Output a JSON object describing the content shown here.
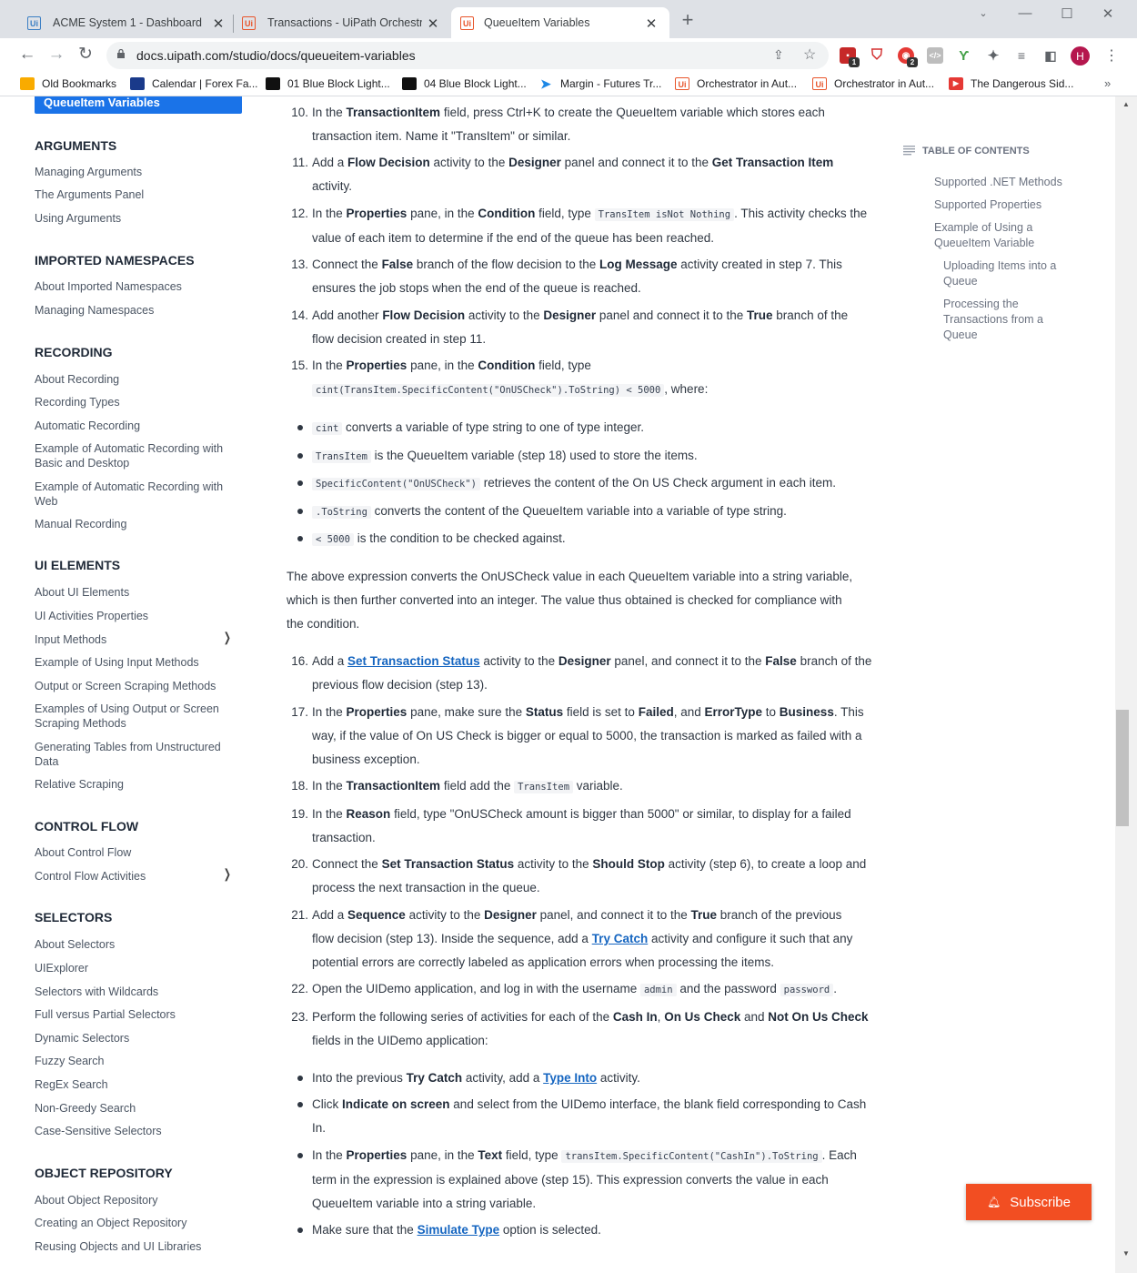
{
  "browser": {
    "tabs": [
      {
        "title": "ACME System 1 - Dashboard",
        "fav": "Ui"
      },
      {
        "title": "Transactions - UiPath Orchestrato",
        "fav": "Ui"
      },
      {
        "title": "QueueItem Variables",
        "fav": "Ui"
      }
    ],
    "new_tab": "+",
    "url": "docs.uipath.com/studio/docs/queueitem-variables",
    "ext_badges": [
      "1",
      "2"
    ],
    "avatar": "H",
    "bookmarks": [
      "Old Bookmarks",
      "Calendar | Forex Fa...",
      "01 Blue Block Light...",
      "04 Blue Block Light...",
      "Margin - Futures Tr...",
      "Orchestrator in Aut...",
      "Orchestrator in Aut...",
      "The Dangerous Sid..."
    ]
  },
  "sidebar": {
    "active": "QueueItem Variables",
    "sections": [
      {
        "head": "ARGUMENTS",
        "items": [
          "Managing Arguments",
          "The Arguments Panel",
          "Using Arguments"
        ]
      },
      {
        "head": "IMPORTED NAMESPACES",
        "items": [
          "About Imported Namespaces",
          "Managing Namespaces"
        ]
      },
      {
        "head": "RECORDING",
        "items": [
          "About Recording",
          "Recording Types",
          "Automatic Recording",
          "Example of Automatic Recording with Basic and Desktop",
          "Example of Automatic Recording with Web",
          "Manual Recording"
        ]
      },
      {
        "head": "UI ELEMENTS",
        "items": [
          "About UI Elements",
          "UI Activities Properties",
          "Input Methods",
          "Example of Using Input Methods",
          "Output or Screen Scraping Methods",
          "Examples of Using Output or Screen Scraping Methods",
          "Generating Tables from Unstructured Data",
          "Relative Scraping"
        ]
      },
      {
        "head": "CONTROL FLOW",
        "items": [
          "About Control Flow",
          "Control Flow Activities"
        ]
      },
      {
        "head": "SELECTORS",
        "items": [
          "About Selectors",
          "UIExplorer",
          "Selectors with Wildcards",
          "Full versus Partial Selectors",
          "Dynamic Selectors",
          "Fuzzy Search",
          "RegEx Search",
          "Non-Greedy Search",
          "Case-Sensitive Selectors"
        ]
      },
      {
        "head": "OBJECT REPOSITORY",
        "items": [
          "About Object Repository",
          "Creating an Object Repository",
          "Reusing Objects and UI Libraries"
        ]
      }
    ]
  },
  "toc": {
    "title": "TABLE OF CONTENTS",
    "items": [
      "Supported .NET Methods",
      "Supported Properties",
      "Example of Using a QueueItem Variable",
      "Uploading Items into a Queue",
      "Processing the Transactions from a Queue"
    ]
  },
  "article": {
    "step10": {
      "n": "10.",
      "a": "In the ",
      "b1": "TransactionItem",
      "c": " field, press Ctrl+K to create the QueueItem variable which stores each",
      "d": "transaction item. Name it \"TransItem\" or similar."
    },
    "step11": {
      "n": "11.",
      "a": "Add a ",
      "b1": "Flow Decision",
      "c": " activity to the ",
      "b2": "Designer",
      "e": " panel and connect it to the ",
      "b3": "Get Transaction Item",
      "f": "activity."
    },
    "step12": {
      "n": "12.",
      "a": "In the ",
      "b1": "Properties",
      "c": " pane, in the ",
      "b2": "Condition",
      "e": " field, type ",
      "code": "TransItem isNot Nothing",
      "g": ". This activity checks the",
      "h": "value of each item to determine if the end of the queue has been reached."
    },
    "step13": {
      "n": "13.",
      "a": "Connect the ",
      "b1": "False",
      "c": " branch of the flow decision to the ",
      "b2": "Log Message",
      "e": " activity created in step 7. This",
      "f": "ensures the job stops when the end of the queue is reached."
    },
    "step14": {
      "n": "14.",
      "a": "Add another ",
      "b1": "Flow Decision",
      "c": " activity to the ",
      "b2": "Designer",
      "e": " panel and connect it to the ",
      "b3": "True",
      "f": " branch of the",
      "g": "flow decision created in step 11."
    },
    "step15": {
      "n": "15.",
      "a": "In the ",
      "b1": "Properties",
      "c": " pane, in the ",
      "b2": "Condition",
      "e": " field, type",
      "code": "cint(TransItem.SpecificContent(\"OnUSCheck\").ToString) < 5000",
      "g": ", where:"
    },
    "bullets15": [
      {
        "code": "cint",
        "t": " converts a variable of type string to one of type integer."
      },
      {
        "code": "TransItem",
        "t": " is the QueueItem variable (step 18) used to store the items."
      },
      {
        "code": "SpecificContent(\"OnUSCheck\")",
        "t": " retrieves the content of the On US Check argument in each item."
      },
      {
        "code": ".ToString",
        "t": " converts the content of the QueueItem variable into a variable of type string."
      },
      {
        "code": "< 5000",
        "t": " is the condition to be checked against."
      }
    ],
    "para": [
      "The above expression converts the OnUSCheck value in each QueueItem variable into a string variable,",
      "which is then further converted into an integer. The value thus obtained is checked for compliance with",
      "the condition."
    ],
    "step16": {
      "n": "16.",
      "a": "Add a ",
      "link": "Set Transaction Status",
      "c": " activity to the ",
      "b1": "Designer",
      "e": " panel, and connect it to the ",
      "b2": "False",
      "f": " branch of the",
      "g": "previous flow decision (step 13)."
    },
    "step17": {
      "n": "17.",
      "a": "In the ",
      "b1": "Properties",
      "c": " pane, make sure the ",
      "b2": "Status",
      "e": " field is set to ",
      "b3": "Failed",
      "f": ", and ",
      "b4": "ErrorType",
      "g": " to ",
      "b5": "Business",
      "h": ". This",
      "i": "way, if the value of On US Check is bigger or equal to 5000, the transaction is marked as failed with a",
      "j": "business exception."
    },
    "step18": {
      "n": "18.",
      "a": "In the ",
      "b1": "TransactionItem",
      "c": " field add the ",
      "code": "TransItem",
      "e": " variable."
    },
    "step19": {
      "n": "19.",
      "a": "In the ",
      "b1": "Reason",
      "c": " field, type \"OnUSCheck amount is bigger than 5000\" or similar, to display for a failed",
      "d": "transaction."
    },
    "step20": {
      "n": "20.",
      "a": "Connect the ",
      "b1": "Set Transaction Status",
      "c": " activity to the ",
      "b2": "Should Stop",
      "e": " activity (step 6), to create a loop and",
      "f": "process the next transaction in the queue."
    },
    "step21": {
      "n": "21.",
      "a": "Add a ",
      "b1": "Sequence",
      "c": " activity to the ",
      "b2": "Designer",
      "e": " panel, and connect it to the ",
      "b3": "True",
      "f": " branch of the previous",
      "g": "flow decision (step 13). Inside the sequence, add a ",
      "link": "Try Catch",
      "h": " activity and configure it such that any",
      "i": "potential errors are correctly labeled as application errors when processing the items."
    },
    "step22": {
      "n": "22.",
      "a": "Open the UIDemo application, and log in with the username ",
      "code1": "admin",
      "c": " and the password ",
      "code2": "password",
      "e": "."
    },
    "step23": {
      "n": "23.",
      "a": "Perform the following series of activities for each of the ",
      "b1": "Cash In",
      "c": ", ",
      "b2": "On Us Check",
      "e": " and ",
      "b3": "Not On Us Check",
      "f": "fields in the UIDemo application:"
    },
    "bullets23": {
      "b1": {
        "a": "Into the previous ",
        "b": "Try Catch",
        "c": " activity, add a ",
        "link": "Type Into",
        "d": " activity."
      },
      "b2": {
        "a": "Click ",
        "b": "Indicate on screen",
        "c": " and select from the UIDemo interface, the blank field corresponding to Cash",
        "d": "In."
      },
      "b3": {
        "a": "In the ",
        "b1": "Properties",
        "c": " pane, in the ",
        "b2": "Text",
        "e": " field, type ",
        "code": "transItem.SpecificContent(\"CashIn\").ToString",
        "g": ". Each",
        "h": "term in the expression is explained above (step 15). This expression converts the value in each",
        "i": "QueueItem variable into a string variable."
      },
      "b4": {
        "a": "Make sure that the ",
        "link": "Simulate Type",
        "c": " option is selected."
      }
    }
  },
  "subscribe": "Subscribe"
}
